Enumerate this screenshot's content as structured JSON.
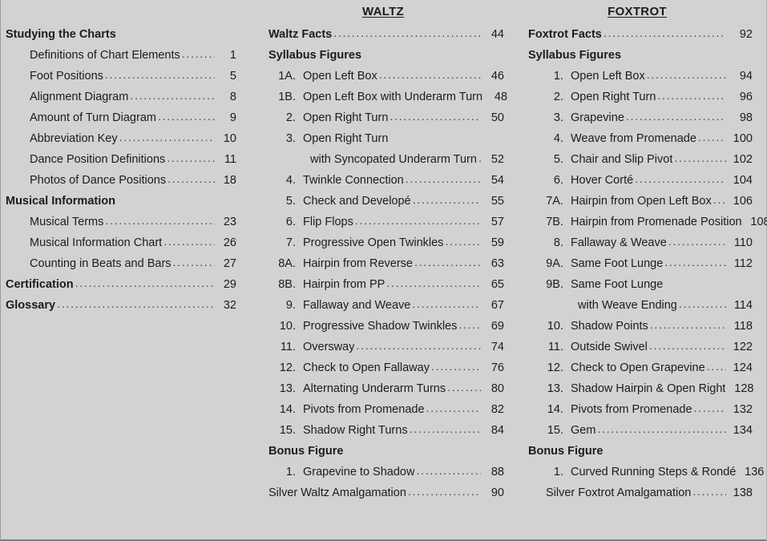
{
  "document": {
    "background_color": "#d2d2d2",
    "text_color": "#1c1c1c"
  },
  "columns": [
    {
      "id": "general",
      "title": "",
      "title_underlined": false,
      "entries": [
        {
          "kind": "heading",
          "num": "",
          "label": "Studying the Charts",
          "page": "",
          "indent": 0
        },
        {
          "kind": "entry",
          "num": "",
          "label": "Definitions of Chart Elements",
          "page": "1",
          "indent": 1
        },
        {
          "kind": "entry",
          "num": "",
          "label": "Foot Positions",
          "page": "5",
          "indent": 1
        },
        {
          "kind": "entry",
          "num": "",
          "label": "Alignment Diagram",
          "page": "8",
          "indent": 1
        },
        {
          "kind": "entry",
          "num": "",
          "label": "Amount of Turn Diagram",
          "page": "9",
          "indent": 1
        },
        {
          "kind": "entry",
          "num": "",
          "label": "Abbreviation Key",
          "page": "10",
          "indent": 1
        },
        {
          "kind": "entry",
          "num": "",
          "label": "Dance Position Definitions",
          "page": "11",
          "indent": 1
        },
        {
          "kind": "entry",
          "num": "",
          "label": "Photos of Dance Positions",
          "page": "18",
          "indent": 1
        },
        {
          "kind": "heading",
          "num": "",
          "label": "Musical Information",
          "page": "",
          "indent": 0
        },
        {
          "kind": "entry",
          "num": "",
          "label": "Musical Terms",
          "page": "23",
          "indent": 1
        },
        {
          "kind": "entry",
          "num": "",
          "label": "Musical Information Chart",
          "page": "26",
          "indent": 1
        },
        {
          "kind": "entry",
          "num": "",
          "label": "Counting in Beats and Bars",
          "page": "27",
          "indent": 1
        },
        {
          "kind": "entry",
          "num": "",
          "label": "Certification",
          "page": "29",
          "indent": 0,
          "bold": true
        },
        {
          "kind": "entry",
          "num": "",
          "label": "Glossary",
          "page": "32",
          "indent": 0,
          "bold": true
        }
      ]
    },
    {
      "id": "waltz",
      "title": "WALTZ",
      "title_underlined": true,
      "entries": [
        {
          "kind": "entry",
          "num": "",
          "label": "Waltz Facts",
          "page": "44",
          "indent": 0,
          "bold": true,
          "flush": true
        },
        {
          "kind": "heading",
          "num": "",
          "label": "Syllabus Figures",
          "page": "",
          "indent": 0
        },
        {
          "kind": "entry",
          "num": "1A.",
          "label": "Open Left Box",
          "page": "46"
        },
        {
          "kind": "entry",
          "num": "1B.",
          "label": "Open Left Box with Underarm Turn",
          "page": "48"
        },
        {
          "kind": "entry",
          "num": "2.",
          "label": "Open Right Turn",
          "page": "50"
        },
        {
          "kind": "nodots",
          "num": "3.",
          "label": "Open Right Turn",
          "page": ""
        },
        {
          "kind": "cont",
          "num": "",
          "label": "with Syncopated Underarm Turn",
          "page": "52"
        },
        {
          "kind": "entry",
          "num": "4.",
          "label": "Twinkle Connection",
          "page": "54"
        },
        {
          "kind": "entry",
          "num": "5.",
          "label": "Check and Developé",
          "page": "55"
        },
        {
          "kind": "entry",
          "num": "6.",
          "label": "Flip Flops",
          "page": "57"
        },
        {
          "kind": "entry",
          "num": "7.",
          "label": "Progressive Open Twinkles",
          "page": "59"
        },
        {
          "kind": "entry",
          "num": "8A.",
          "label": "Hairpin from Reverse",
          "page": "63"
        },
        {
          "kind": "entry",
          "num": "8B.",
          "label": "Hairpin from PP",
          "page": "65"
        },
        {
          "kind": "entry",
          "num": "9.",
          "label": "Fallaway and Weave",
          "page": "67"
        },
        {
          "kind": "entry",
          "num": "10.",
          "label": "Progressive Shadow Twinkles",
          "page": "69"
        },
        {
          "kind": "entry",
          "num": "11.",
          "label": "Oversway",
          "page": "74"
        },
        {
          "kind": "entry",
          "num": "12.",
          "label": "Check to Open Fallaway",
          "page": "76"
        },
        {
          "kind": "entry",
          "num": "13.",
          "label": "Alternating Underarm Turns",
          "page": "80"
        },
        {
          "kind": "entry",
          "num": "14.",
          "label": "Pivots from Promenade",
          "page": "82"
        },
        {
          "kind": "entry",
          "num": "15.",
          "label": "Shadow Right Turns",
          "page": "84"
        },
        {
          "kind": "heading",
          "num": "",
          "label": "Bonus Figure",
          "page": "",
          "indent": 0
        },
        {
          "kind": "entry",
          "num": "1.",
          "label": "Grapevine to Shadow",
          "page": "88"
        },
        {
          "kind": "entry",
          "num": "",
          "label": "Silver Waltz Amalgamation",
          "page": "90",
          "flush": true
        }
      ]
    },
    {
      "id": "foxtrot",
      "title": "FOXTROT",
      "title_underlined": true,
      "entries": [
        {
          "kind": "entry",
          "num": "",
          "label": "Foxtrot Facts",
          "page": "92",
          "indent": 0,
          "bold": true,
          "flush": true
        },
        {
          "kind": "heading",
          "num": "",
          "label": "Syllabus Figures",
          "page": "",
          "indent": 0
        },
        {
          "kind": "entry",
          "num": "1.",
          "label": "Open Left Box",
          "page": "94"
        },
        {
          "kind": "entry",
          "num": "2.",
          "label": "Open Right Turn",
          "page": "96"
        },
        {
          "kind": "entry",
          "num": "3.",
          "label": "Grapevine",
          "page": "98"
        },
        {
          "kind": "entry",
          "num": "4.",
          "label": "Weave from Promenade",
          "page": "100"
        },
        {
          "kind": "entry",
          "num": "5.",
          "label": "Chair and Slip Pivot",
          "page": "102"
        },
        {
          "kind": "entry",
          "num": "6.",
          "label": "Hover Corté",
          "page": "104"
        },
        {
          "kind": "entry",
          "num": "7A.",
          "label": "Hairpin from Open Left Box",
          "page": "106"
        },
        {
          "kind": "entry",
          "num": "7B.",
          "label": "Hairpin from Promenade Position",
          "page": "108"
        },
        {
          "kind": "entry",
          "num": "8.",
          "label": "Fallaway & Weave",
          "page": "110"
        },
        {
          "kind": "entry",
          "num": "9A.",
          "label": "Same Foot Lunge",
          "page": "112"
        },
        {
          "kind": "nodots",
          "num": "9B.",
          "label": "Same Foot Lunge",
          "page": ""
        },
        {
          "kind": "cont",
          "num": "",
          "label": "with Weave Ending",
          "page": "114"
        },
        {
          "kind": "entry",
          "num": "10.",
          "label": "Shadow Points",
          "page": "118"
        },
        {
          "kind": "entry",
          "num": "11.",
          "label": "Outside Swivel",
          "page": "122"
        },
        {
          "kind": "entry",
          "num": "12.",
          "label": "Check to Open Grapevine",
          "page": "124"
        },
        {
          "kind": "entry",
          "num": "13.",
          "label": "Shadow Hairpin & Open Right",
          "page": "128"
        },
        {
          "kind": "entry",
          "num": "14.",
          "label": "Pivots from Promenade",
          "page": "132"
        },
        {
          "kind": "entry",
          "num": "15.",
          "label": "Gem",
          "page": "134"
        },
        {
          "kind": "heading",
          "num": "",
          "label": "Bonus Figure",
          "page": "",
          "indent": 0
        },
        {
          "kind": "entry",
          "num": "1.",
          "label": "Curved Running Steps & Rondé",
          "page": "136"
        },
        {
          "kind": "entry",
          "num": "",
          "label": "Silver Foxtrot Amalgamation",
          "page": "138",
          "silver": true,
          "flush": true
        }
      ]
    }
  ]
}
